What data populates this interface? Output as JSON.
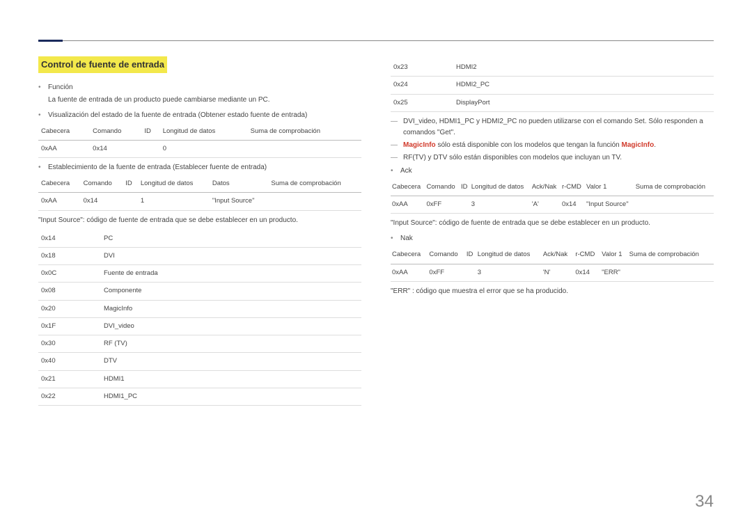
{
  "section_title": "Control de fuente de entrada",
  "left": {
    "funcion_label": "Función",
    "funcion_desc": "La fuente de entrada de un producto puede cambiarse mediante un PC.",
    "view_label": "Visualización del estado de la fuente de entrada (Obtener estado fuente de entrada)",
    "table1_headers": [
      "Cabecera",
      "Comando",
      "ID",
      "Longitud de datos",
      "Suma de comprobación"
    ],
    "table1_row": [
      "0xAA",
      "0x14",
      "",
      "0",
      ""
    ],
    "set_label": "Establecimiento de la fuente de entrada (Establecer fuente de entrada)",
    "table2_headers": [
      "Cabecera",
      "Comando",
      "ID",
      "Longitud de datos",
      "Datos",
      "Suma de comprobación"
    ],
    "table2_row": [
      "0xAA",
      "0x14",
      "",
      "1",
      "\"Input Source\"",
      ""
    ],
    "input_source_note": "\"Input Source\": código de fuente de entrada que se debe establecer en un producto.",
    "sources": [
      [
        "0x14",
        "PC"
      ],
      [
        "0x18",
        "DVI"
      ],
      [
        "0x0C",
        "Fuente de entrada"
      ],
      [
        "0x08",
        "Componente"
      ],
      [
        "0x20",
        "MagicInfo"
      ],
      [
        "0x1F",
        "DVI_video"
      ],
      [
        "0x30",
        "RF (TV)"
      ],
      [
        "0x40",
        "DTV"
      ],
      [
        "0x21",
        "HDMI1"
      ],
      [
        "0x22",
        "HDMI1_PC"
      ]
    ]
  },
  "right": {
    "sources_cont": [
      [
        "0x23",
        "HDMI2"
      ],
      [
        "0x24",
        "HDMI2_PC"
      ],
      [
        "0x25",
        "DisplayPort"
      ]
    ],
    "dash1_pre": "DVI_video, HDMI1_PC y HDMI2_PC no pueden utilizarse con el comando Set. Sólo responden a comandos \"Get\".",
    "dash2_brand": "MagicInfo",
    "dash2_rest": " sólo está disponible con los modelos que tengan la función ",
    "dash2_brand2": "MagicInfo",
    "dash2_rest2": ".",
    "dash3": "RF(TV) y DTV sólo están disponibles con modelos que incluyan un TV.",
    "ack_label": "Ack",
    "ack_headers": [
      "Cabecera",
      "Comando",
      "ID",
      "Longitud de datos",
      "Ack/Nak",
      "r-CMD",
      "Valor 1",
      "Suma de comprobación"
    ],
    "ack_row": [
      "0xAA",
      "0xFF",
      "",
      "3",
      "'A'",
      "0x14",
      "\"Input Source\"",
      ""
    ],
    "ack_note": "\"Input Source\": código de fuente de entrada que se debe establecer en un producto.",
    "nak_label": "Nak",
    "nak_headers": [
      "Cabecera",
      "Comando",
      "ID",
      "Longitud de datos",
      "Ack/Nak",
      "r-CMD",
      "Valor 1",
      "Suma de comprobación"
    ],
    "nak_row": [
      "0xAA",
      "0xFF",
      "",
      "3",
      "'N'",
      "0x14",
      "\"ERR\"",
      ""
    ],
    "err_note": "\"ERR\" : código que muestra el error que se ha producido."
  },
  "page_number": "34"
}
